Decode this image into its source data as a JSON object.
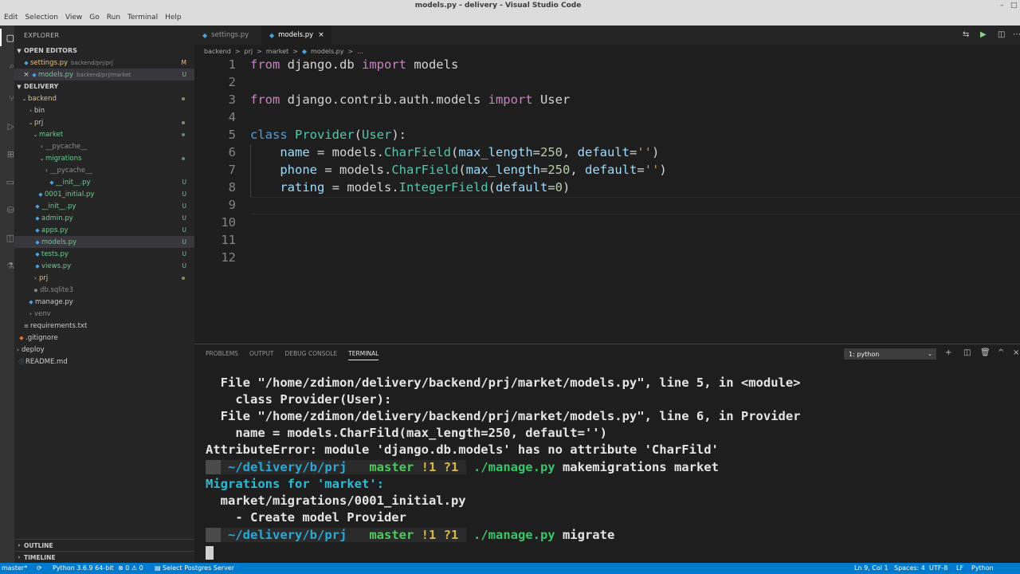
{
  "window": {
    "title": "models.py - delivery - Visual Studio Code",
    "controls": [
      "–",
      "□",
      "×"
    ]
  },
  "menu": [
    "Edit",
    "Selection",
    "View",
    "Go",
    "Run",
    "Terminal",
    "Help"
  ],
  "sidebar": {
    "title": "EXPLORER",
    "open_editors_label": "OPEN EDITORS",
    "open_editors": [
      {
        "name": "settings.py",
        "path": "backend/prj/prj",
        "badge": "M"
      },
      {
        "name": "models.py",
        "path": "backend/prj/market",
        "badge": "U",
        "close": "×"
      }
    ],
    "project_label": "DELIVERY",
    "tree": [
      {
        "name": "backend",
        "badge": ""
      },
      {
        "name": "bin",
        "badge": ""
      },
      {
        "name": "prj",
        "badge": ""
      },
      {
        "name": "market",
        "badge": ""
      },
      {
        "name": "__pycache__",
        "badge": ""
      },
      {
        "name": "migrations",
        "badge": ""
      },
      {
        "name": "__pycache__",
        "badge": ""
      },
      {
        "name": "__init__.py",
        "badge": "U"
      },
      {
        "name": "0001_initial.py",
        "badge": "U"
      },
      {
        "name": "__init__.py",
        "badge": "U"
      },
      {
        "name": "admin.py",
        "badge": "U"
      },
      {
        "name": "apps.py",
        "badge": "U"
      },
      {
        "name": "models.py",
        "badge": "U"
      },
      {
        "name": "tests.py",
        "badge": "U"
      },
      {
        "name": "views.py",
        "badge": "U"
      },
      {
        "name": "prj",
        "badge": ""
      },
      {
        "name": "db.sqlite3",
        "badge": ""
      },
      {
        "name": "manage.py",
        "badge": ""
      },
      {
        "name": "venv",
        "badge": ""
      },
      {
        "name": "requirements.txt",
        "badge": ""
      },
      {
        "name": ".gitignore",
        "badge": ""
      },
      {
        "name": "deploy",
        "badge": ""
      },
      {
        "name": "README.md",
        "badge": ""
      }
    ],
    "outline_label": "OUTLINE",
    "timeline_label": "TIMELINE"
  },
  "tabs": [
    {
      "label": "settings.py"
    },
    {
      "label": "models.py",
      "close": "×"
    }
  ],
  "breadcrumbs": [
    "backend",
    ">",
    "prj",
    ">",
    "market",
    ">",
    "models.py",
    ">",
    "..."
  ],
  "editor": {
    "line_numbers": [
      "1",
      "2",
      "3",
      "4",
      "5",
      "6",
      "7",
      "8",
      "9",
      "10",
      "11",
      "12"
    ],
    "lines": {
      "l1": {
        "kw": "from",
        "mod": " django.db ",
        "kw2": "import",
        "rest": " models"
      },
      "l3": {
        "kw": "from",
        "mod": " django.contrib.auth.models ",
        "kw2": "import",
        "rest": " User"
      },
      "l5": {
        "kw": "class",
        "cls": " Provider",
        "p1": "(",
        "base": "User",
        "p2": "):"
      },
      "l6": {
        "var": "    name",
        "eq": " = models.",
        "fn": "CharField",
        "o": "(",
        "p": "max_length",
        "e": "=",
        "n": "250",
        "c": ", ",
        "p2": "default",
        "e2": "=",
        "s": "''",
        "cl": ")"
      },
      "l7": {
        "var": "    phone",
        "eq": " = models.",
        "fn": "CharField",
        "o": "(",
        "p": "max_length",
        "e": "=",
        "n": "250",
        "c": ", ",
        "p2": "default",
        "e2": "=",
        "s": "''",
        "cl": ")"
      },
      "l8": {
        "var": "    rating",
        "eq": " = models.",
        "fn": "IntegerField",
        "o": "(",
        "p": "default",
        "e": "=",
        "n": "0",
        "cl": ")"
      }
    }
  },
  "panel": {
    "tabs": [
      "PROBLEMS",
      "OUTPUT",
      "DEBUG CONSOLE",
      "TERMINAL"
    ],
    "terminal_select": "1: python",
    "terminal": {
      "t1": "  File \"/home/zdimon/delivery/backend/prj/market/models.py\", line 5, in <module>",
      "t2": "    class Provider(User):",
      "t3": "  File \"/home/zdimon/delivery/backend/prj/market/models.py\", line 6, in Provider",
      "t4": "    name = models.CharFild(max_length=250, default='')",
      "t5": "AttributeError: module 'django.db.models' has no attribute 'CharFild'",
      "prompt_os": "  ",
      "prompt_dir": " ~/delivery/b/prj ",
      "prompt_git": "  master ",
      "prompt_status": "!1 ?1 ",
      "cmd1_exe": " ./manage.py",
      "cmd1_args": " makemigrations market",
      "t7": "Migrations for 'market':",
      "t8": "  market/migrations/0001_initial.py",
      "t9": "    - Create model Provider",
      "cmd2_exe": " ./manage.py",
      "cmd2_args": " migrate"
    }
  },
  "status": {
    "branch": "master*",
    "sync": "⟳",
    "python": "Python 3.6.9 64-bit",
    "problems": "⊗ 0 ⚠ 0",
    "postgres": "Select Postgres Server",
    "position": "Ln 9, Col 1",
    "spaces": "Spaces: 4",
    "encoding": "UTF-8",
    "eol": "LF",
    "language": "Python"
  },
  "colors": {
    "status_bar": "#007acc",
    "editor_bg": "#1e1e1e",
    "sidebar_bg": "#252526"
  }
}
